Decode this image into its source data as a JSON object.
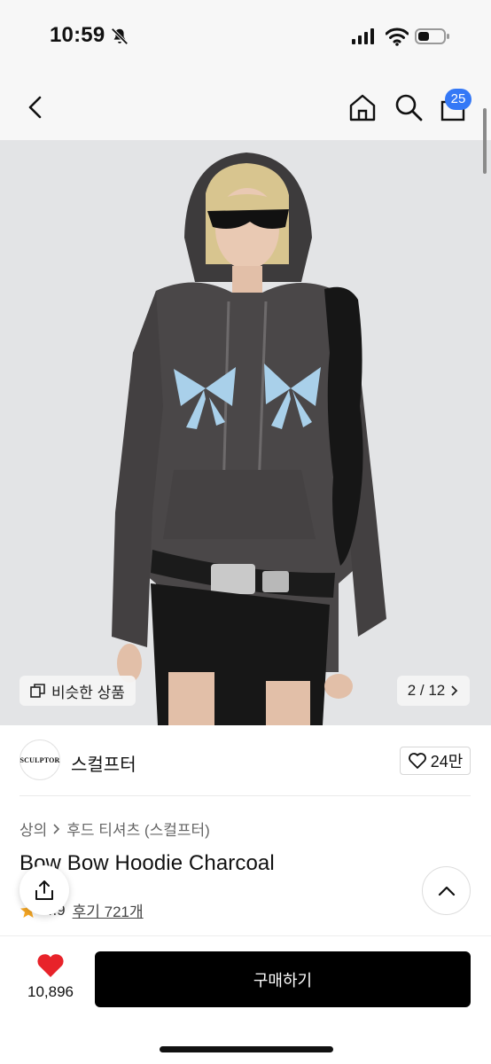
{
  "status": {
    "time": "10:59"
  },
  "nav": {
    "cart_count": "25",
    "icons": [
      "back-icon",
      "home-icon",
      "search-icon",
      "shopping-bag-icon"
    ]
  },
  "gallery": {
    "similar_label": "비슷한 상품",
    "page_indicator": "2 / 12",
    "colors": {
      "hoodie": "#4a4748",
      "bows": "#a9d0ea",
      "background": "#e3e4e6"
    }
  },
  "brand": {
    "logo_text": "SCULPTOR",
    "name": "스컬프터",
    "likes": "24만"
  },
  "product": {
    "breadcrumb": [
      "상의",
      "후드 티셔츠 (스컬프터)"
    ],
    "title": "Bow Bow Hoodie Charcoal",
    "rating": "4.9",
    "reviews": "후기 721개"
  },
  "bottom": {
    "wish_count": "10,896",
    "buy_label": "구매하기",
    "accent_colors": {
      "heart": "#e8232a",
      "badge": "#3478f6",
      "button": "#000000"
    }
  }
}
